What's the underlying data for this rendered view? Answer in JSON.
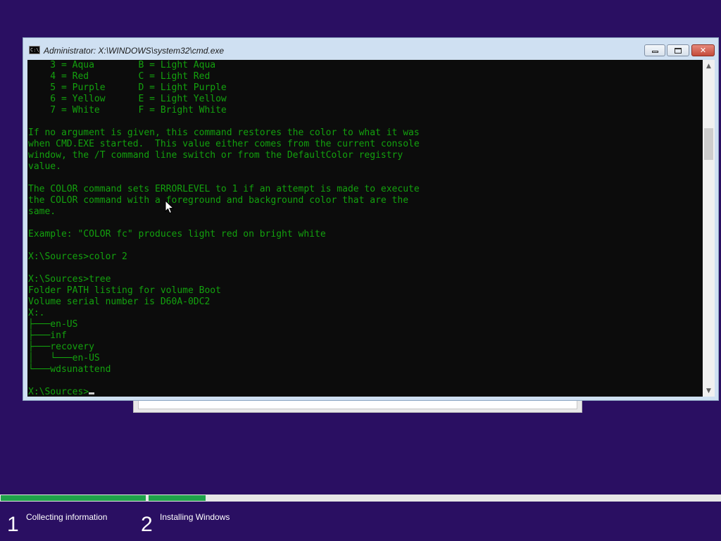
{
  "window": {
    "title": "Administrator: X:\\WINDOWS\\system32\\cmd.exe",
    "icon_text": "C:\\",
    "buttons": {
      "minimize": "minimize",
      "maximize": "maximize",
      "close": "✕"
    }
  },
  "console": {
    "prompt": "X:\\Sources>",
    "text": "    3 = Aqua        B = Light Aqua\n    4 = Red         C = Light Red\n    5 = Purple      D = Light Purple\n    6 = Yellow      E = Light Yellow\n    7 = White       F = Bright White\n\nIf no argument is given, this command restores the color to what it was\nwhen CMD.EXE started.  This value either comes from the current console\nwindow, the /T command line switch or from the DefaultColor registry\nvalue.\n\nThe COLOR command sets ERRORLEVEL to 1 if an attempt is made to execute\nthe COLOR command with a foreground and background color that are the\nsame.\n\nExample: \"COLOR fc\" produces light red on bright white\n\nX:\\Sources>color 2\n\nX:\\Sources>tree\nFolder PATH listing for volume Boot\nVolume serial number is D60A-0DC2\nX:.\n├───en-US\n├───inf\n├───recovery\n│   └───en-US\n└───wdsunattend\n\n",
    "text_color": "#13a10e",
    "background_color": "#0c0c0c"
  },
  "setup_progress": {
    "steps": [
      {
        "number": "1",
        "label": "Collecting information",
        "progress": 1.0
      },
      {
        "number": "2",
        "label": "Installing Windows",
        "progress": 0.1
      }
    ],
    "accent_color": "#1fa24a"
  },
  "colors": {
    "desktop_background": "#2a0f62",
    "window_frame": "#cfe0f2"
  }
}
